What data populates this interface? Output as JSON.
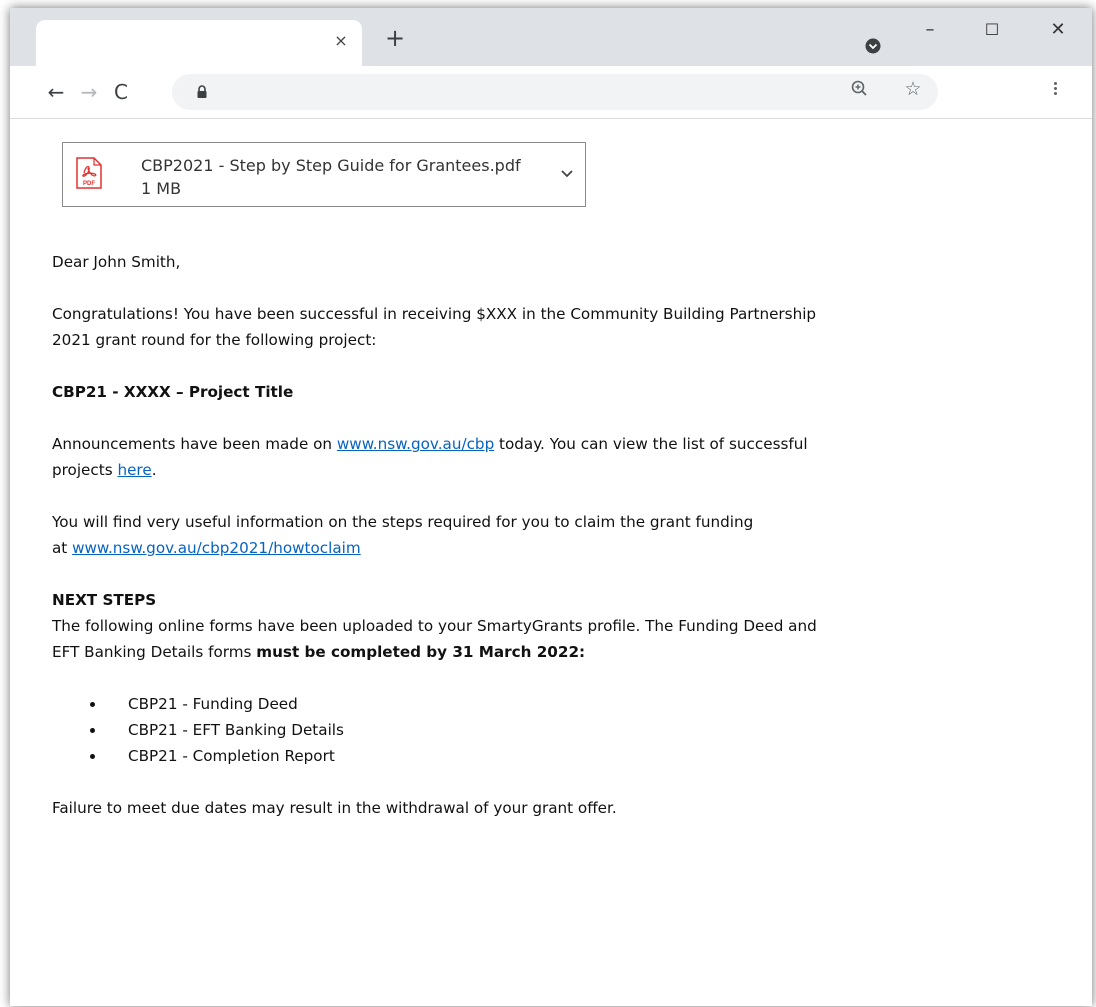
{
  "browser": {
    "tab": {
      "title": "",
      "close_glyph": "×"
    },
    "new_tab_glyph": "+",
    "window_controls": {
      "minimize": "–",
      "maximize": "☐",
      "close": "✕"
    },
    "toolbar": {
      "back_glyph": "←",
      "forward_glyph": "→",
      "reload_glyph": "C",
      "address": "",
      "star_glyph": "☆"
    },
    "icons": [
      "profile-icon",
      "lock-icon",
      "zoom-icon",
      "bookmark-star-icon",
      "menu-icon"
    ]
  },
  "attachment": {
    "filename": "CBP2021 - Step by Step Guide for Grantees.pdf",
    "size": "1 MB",
    "icon_label": "PDF",
    "icon_color": "#e2312f"
  },
  "email": {
    "greeting": "Dear John Smith,",
    "congrats_line1": "Congratulations! You have been successful in receiving $XXX in the Community Building Partnership",
    "congrats_line2": "2021 grant round for the following project:",
    "project_title": "CBP21 - XXXX – Project Title",
    "announce_pre": "Announcements have been made on ",
    "announce_link": "www.nsw.gov.au/cbp",
    "announce_mid": " today. You can view the list of successful",
    "announce_pre2": "projects ",
    "announce_here": "here",
    "announce_end": ".",
    "useful_line1": "You will find very useful information on the steps required for you to claim the grant funding",
    "useful_pre": "at ",
    "useful_link": "www.nsw.gov.au/cbp2021/howtoclaim",
    "next_steps_heading": "NEXT STEPS",
    "next_line1": "The following online forms have been uploaded to your SmartyGrants profile. The Funding Deed and",
    "next_line2_pre": "EFT Banking Details forms ",
    "next_line2_bold": "must be completed by 31 March 2022:",
    "forms": [
      "CBP21 - Funding Deed",
      "CBP21 - EFT Banking Details",
      "CBP21 - Completion Report"
    ],
    "failure_line": "Failure to meet due dates may result in the withdrawal of your grant offer."
  },
  "colors": {
    "link": "#0563c1",
    "tabstrip": "#dee1e6",
    "omnibox": "#f1f3f4"
  }
}
